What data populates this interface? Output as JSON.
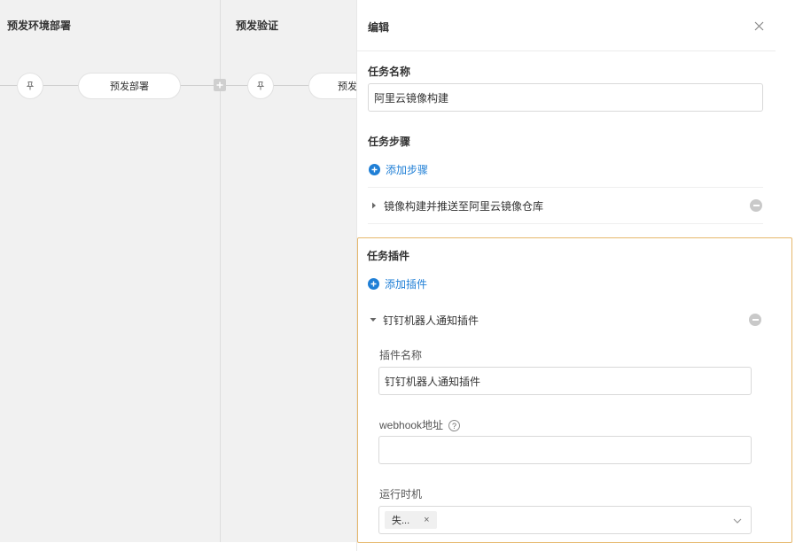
{
  "pipeline": {
    "stages": [
      {
        "title": "预发环境部署",
        "job_label": "预发部署",
        "node_icon": "pin-icon"
      },
      {
        "title": "预发验证",
        "job_label": "预发验证",
        "node_icon": "pin-icon"
      }
    ],
    "add_icon": "add-square-icon"
  },
  "panel": {
    "title": "编辑",
    "close_icon": "close-icon",
    "task_name": {
      "label": "任务名称",
      "value": "阿里云镜像构建"
    },
    "task_steps": {
      "label": "任务步骤",
      "add_label": "添加步骤",
      "items": [
        {
          "label": "镜像构建并推送至阿里云镜像仓库",
          "expanded": false
        }
      ]
    },
    "task_plugins": {
      "label": "任务插件",
      "add_label": "添加插件",
      "items": [
        {
          "label": "钉钉机器人通知插件",
          "expanded": true,
          "fields": {
            "plugin_name": {
              "label": "插件名称",
              "value": "钉钉机器人通知插件"
            },
            "webhook": {
              "label": "webhook地址",
              "help": "?",
              "value": ""
            },
            "run_timing": {
              "label": "运行时机",
              "tags": [
                "失..."
              ],
              "tag_close": "×"
            }
          }
        }
      ]
    }
  },
  "colors": {
    "accent": "#1f7fd6",
    "highlight_border": "#e6b76b",
    "canvas_bg": "#f1f1f1"
  }
}
